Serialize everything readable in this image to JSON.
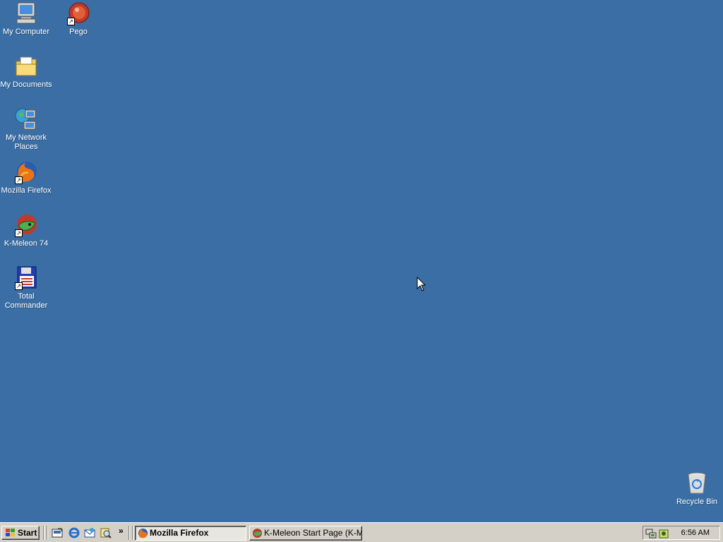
{
  "desktop": {
    "icons": [
      {
        "label": "My Computer",
        "icon": "my-computer-icon"
      },
      {
        "label": "Pego",
        "icon": "pego-icon"
      },
      {
        "label": "My Documents",
        "icon": "my-documents-icon"
      },
      {
        "label": "My Network Places",
        "icon": "network-places-icon"
      },
      {
        "label": "Mozilla Firefox",
        "icon": "firefox-icon"
      },
      {
        "label": "K-Meleon 74",
        "icon": "k-meleon-icon"
      },
      {
        "label": "Total Commander",
        "icon": "total-commander-icon"
      },
      {
        "label": "Recycle Bin",
        "icon": "recycle-bin-icon"
      }
    ],
    "background_color": "#3a6ea5"
  },
  "taskbar": {
    "start_label": "Start",
    "quick_launch": [
      "show-desktop-icon",
      "internet-explorer-icon",
      "outlook-express-icon",
      "search-icon"
    ],
    "more_label": "»",
    "tasks": [
      {
        "label": "Mozilla Firefox",
        "active": true
      },
      {
        "label": "K-Meleon Start Page (K-M...",
        "active": false
      }
    ],
    "clock": "6:56 AM"
  }
}
